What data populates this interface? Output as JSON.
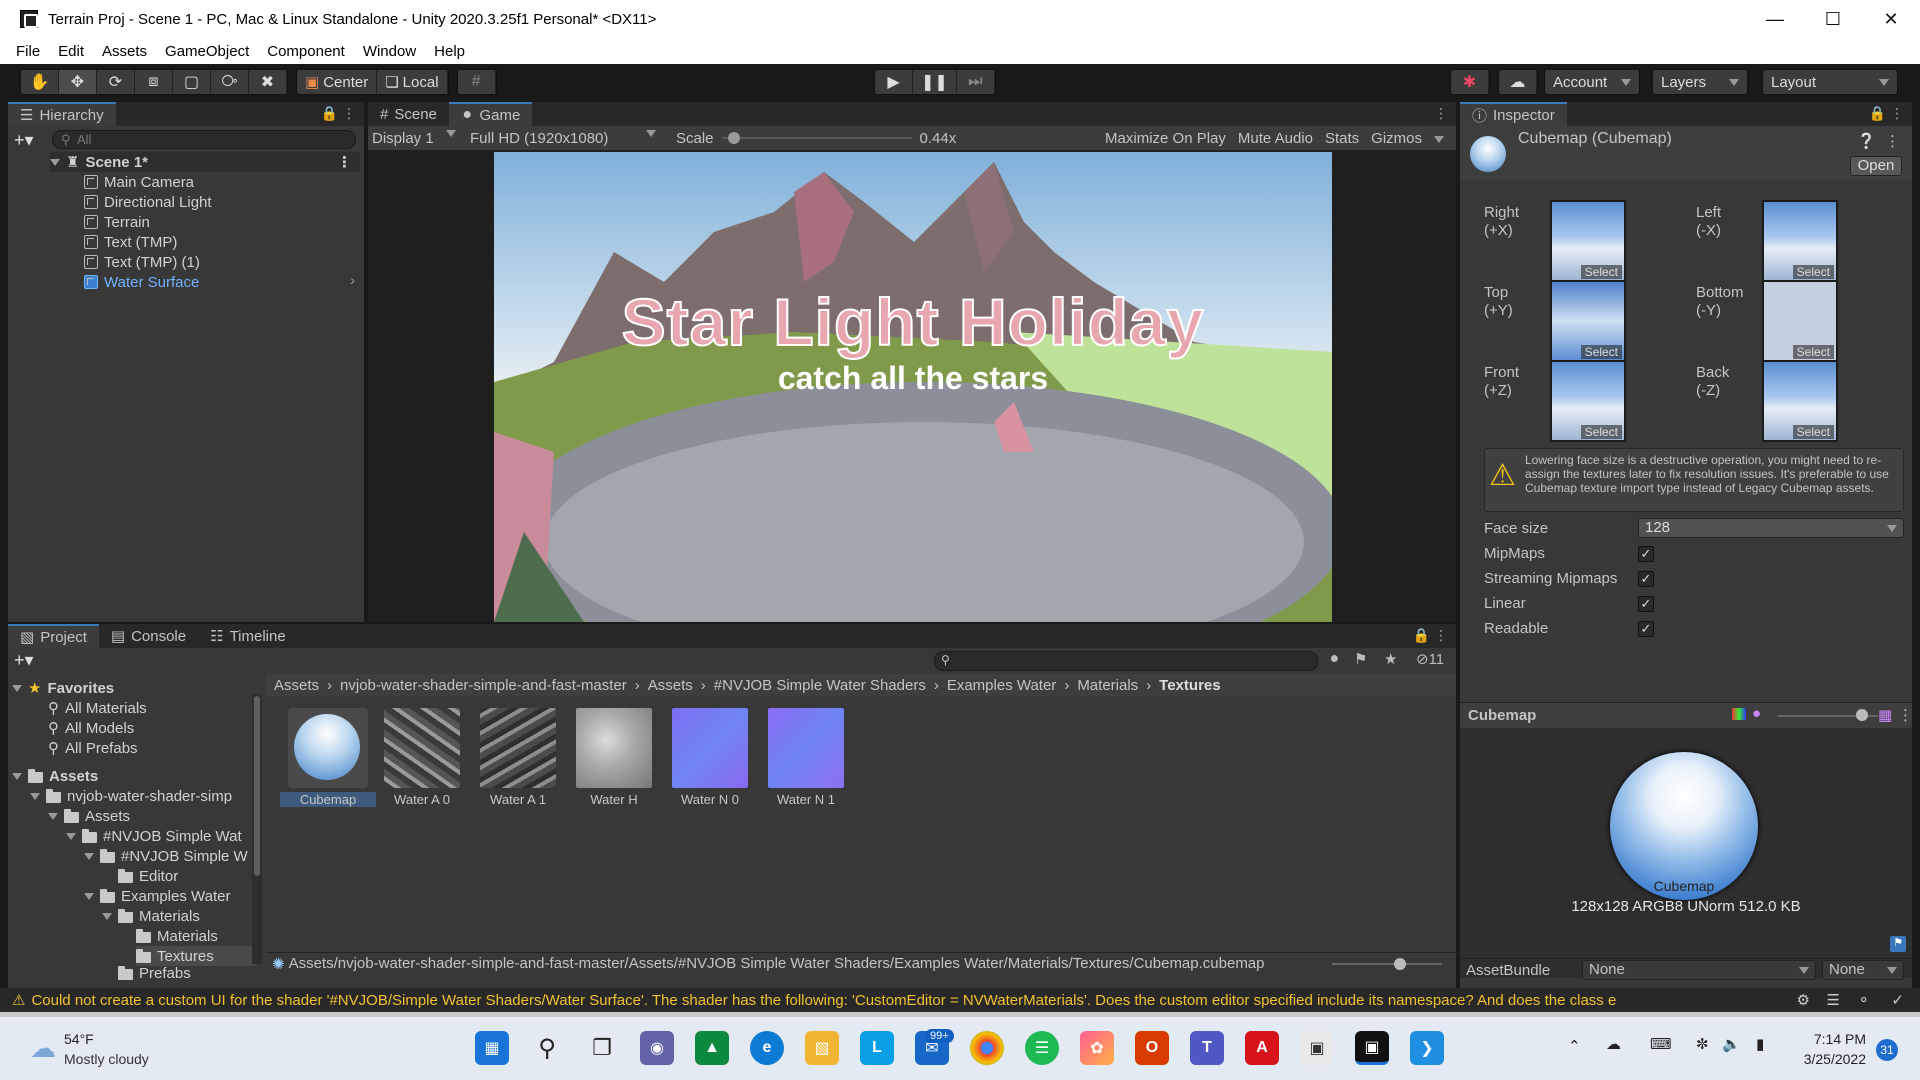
{
  "window": {
    "title": "Terrain Proj - Scene 1 - PC, Mac & Linux Standalone - Unity 2020.3.25f1 Personal* <DX11>"
  },
  "menu": [
    "File",
    "Edit",
    "Assets",
    "GameObject",
    "Component",
    "Window",
    "Help"
  ],
  "toolbar": {
    "center": "Center",
    "local": "Local",
    "account": "Account",
    "layers": "Layers",
    "layout": "Layout"
  },
  "hierarchy": {
    "tab": "Hierarchy",
    "search_placeholder": "All",
    "scene": "Scene 1*",
    "items": [
      "Main Camera",
      "Directional Light",
      "Terrain",
      "Text (TMP)",
      "Text (TMP) (1)",
      "Water Surface"
    ]
  },
  "game": {
    "tabs": [
      "Scene",
      "Game"
    ],
    "display": "Display 1",
    "resolution": "Full HD (1920x1080)",
    "scale_label": "Scale",
    "scale_value": "0.44x",
    "options": [
      "Maximize On Play",
      "Mute Audio",
      "Stats",
      "Gizmos"
    ],
    "title": "Star Light Holiday",
    "subtitle": "catch all the stars"
  },
  "project": {
    "tabs": [
      "Project",
      "Console",
      "Timeline"
    ],
    "hidden_count": "11",
    "favorites": {
      "label": "Favorites",
      "items": [
        "All Materials",
        "All Models",
        "All Prefabs"
      ]
    },
    "assets_label": "Assets",
    "tree": [
      "nvjob-water-shader-simp",
      "Assets",
      "#NVJOB Simple Wat",
      "#NVJOB Simple W",
      "Editor",
      "Examples Water",
      "Materials",
      "Materials",
      "Textures",
      "Prefabs"
    ],
    "breadcrumb": [
      "Assets",
      "nvjob-water-shader-simple-and-fast-master",
      "Assets",
      "#NVJOB Simple Water Shaders",
      "Examples Water",
      "Materials",
      "Textures"
    ],
    "thumbnails": [
      "Cubemap",
      "Water A 0",
      "Water A 1",
      "Water H",
      "Water N 0",
      "Water N 1"
    ],
    "path": "Assets/nvjob-water-shader-simple-and-fast-master/Assets/#NVJOB Simple Water Shaders/Examples Water/Materials/Textures/Cubemap.cubemap"
  },
  "inspector": {
    "tab": "Inspector",
    "title": "Cubemap (Cubemap)",
    "open": "Open",
    "faces": [
      {
        "name": "Right",
        "axis": "(+X)"
      },
      {
        "name": "Left",
        "axis": "(-X)"
      },
      {
        "name": "Top",
        "axis": "(+Y)"
      },
      {
        "name": "Bottom",
        "axis": "(-Y)"
      },
      {
        "name": "Front",
        "axis": "(+Z)"
      },
      {
        "name": "Back",
        "axis": "(-Z)"
      }
    ],
    "select_label": "Select",
    "warning": "Lowering face size is a destructive operation, you might need to re-assign the textures later to fix resolution issues. It's preferable to use Cubemap texture import type instead of Legacy Cubemap assets.",
    "face_size_label": "Face size",
    "face_size_value": "128",
    "checks": [
      "MipMaps",
      "Streaming Mipmaps",
      "Linear",
      "Readable"
    ],
    "preview_title": "Cubemap",
    "preview_label": "Cubemap",
    "preview_info": "128x128  ARGB8 UNorm   512.0 KB",
    "assetbundle_label": "AssetBundle",
    "assetbundle_value": "None",
    "assetbundle_variant": "None"
  },
  "status": {
    "message": "Could not create a custom UI for the shader '#NVJOB/Simple Water Shaders/Water Surface'. The shader has the following: 'CustomEditor = NVWaterMaterials'. Does the custom editor specified include its namespace? And does the class e"
  },
  "taskbar": {
    "temp": "54°F",
    "weather": "Mostly cloudy",
    "mail_badge": "99+",
    "time": "7:14 PM",
    "date": "3/25/2022",
    "notif_count": "31"
  }
}
